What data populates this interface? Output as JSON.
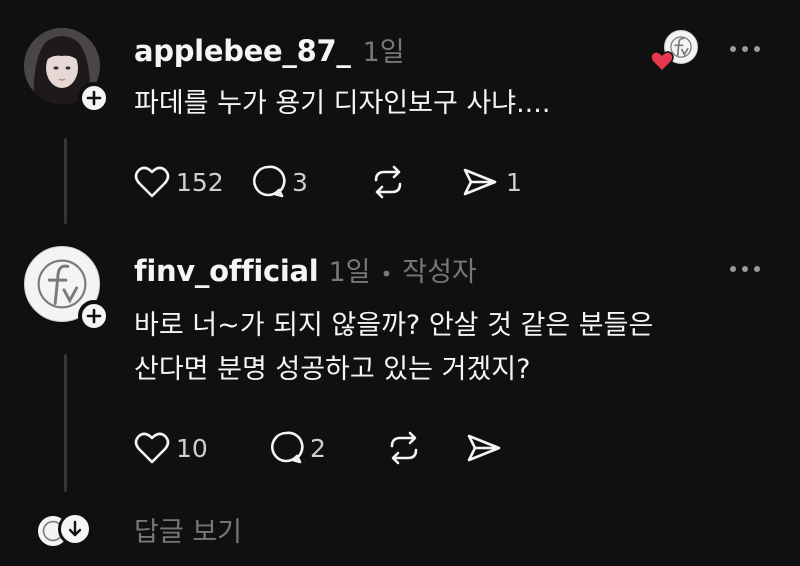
{
  "posts": [
    {
      "username": "applebee_87_",
      "time": "1일",
      "author_tag": "",
      "text_lines": [
        "파데를 누가 용기 디자인보구 사냐...."
      ],
      "likes": "152",
      "replies": "3",
      "shares": "1",
      "liked_by_author": true
    },
    {
      "username": "finv_official",
      "time": "1일",
      "separator": "•",
      "author_tag": "작성자",
      "text_lines": [
        "바로 너~가 되지 않을까? 안살 것 같은 분들은",
        "산다면 분명 성공하고 있는 거겠지?"
      ],
      "likes": "10",
      "replies": "2",
      "shares": ""
    }
  ],
  "footer": {
    "view_replies_label": "답글 보기"
  },
  "icons": [
    "plus-icon",
    "more-icon",
    "heart-icon",
    "comment-icon",
    "repost-icon",
    "share-icon",
    "chevron-down-icon"
  ],
  "colors": {
    "background": "#101010",
    "text": "#f3f5f7",
    "muted": "#777777",
    "heart": "#e8384f"
  }
}
